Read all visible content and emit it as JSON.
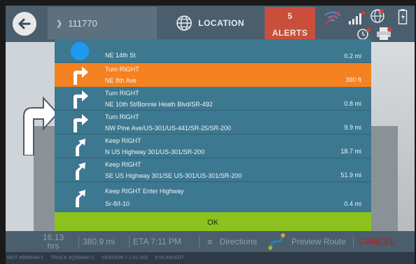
{
  "topbar": {
    "route_number": "111770",
    "location_label": "LOCATION",
    "alerts_count": "5",
    "alerts_label": "ALERTS"
  },
  "directions": [
    {
      "maneuver": "",
      "street": "NE 14th St",
      "distance": "0.2 mi",
      "icon": "current-location-dot-icon",
      "active": false
    },
    {
      "maneuver": "Turn RIGHT",
      "street": "NE 8th Ave",
      "distance": "390 ft",
      "icon": "turn-right-icon",
      "active": true
    },
    {
      "maneuver": "Turn RIGHT",
      "street": "NE 10th St/Bonnie Heath Blvd/SR-492",
      "distance": "0.8 mi",
      "icon": "turn-right-icon",
      "active": false
    },
    {
      "maneuver": "Turn RIGHT",
      "street": "NW Pine Ave/US-301/US-441/SR-25/SR-200",
      "distance": "9.9 mi",
      "icon": "turn-right-icon",
      "active": false
    },
    {
      "maneuver": "Keep RIGHT",
      "street": "N US Highway 301/US-301/SR-200",
      "distance": "18.7 mi",
      "icon": "keep-right-icon",
      "active": false
    },
    {
      "maneuver": "Keep RIGHT",
      "street": "SE US Highway 301/SE US-301/US-301/SR-200",
      "distance": "51.9 mi",
      "icon": "keep-right-icon",
      "active": false
    },
    {
      "maneuver": "Keep RIGHT Enter Highway",
      "street": "Sr-8/I-10",
      "distance": "0.4 mi",
      "icon": "keep-right-icon",
      "active": false
    }
  ],
  "ok_label": "OK",
  "bottombar": {
    "time_value": "16.13",
    "time_unit": "hrs",
    "distance": "380.9 mi",
    "eta": "ETA 7:11 PM",
    "directions_label": "Directions",
    "preview_label": "Preview Route",
    "cancel_label": "CANCEL"
  },
  "footer": {
    "mdt": "MDT #99944471",
    "truck": "TRUCK #Q9944471",
    "version": "VERSION  7.1.61.002",
    "time": "8:55 AM EDT"
  },
  "colors": {
    "accent_orange": "#f58220",
    "ok_green": "#8bc21d",
    "alerts_red": "#c94f3c",
    "cancel_red": "#b22424",
    "list_teal": "#3c7890"
  }
}
